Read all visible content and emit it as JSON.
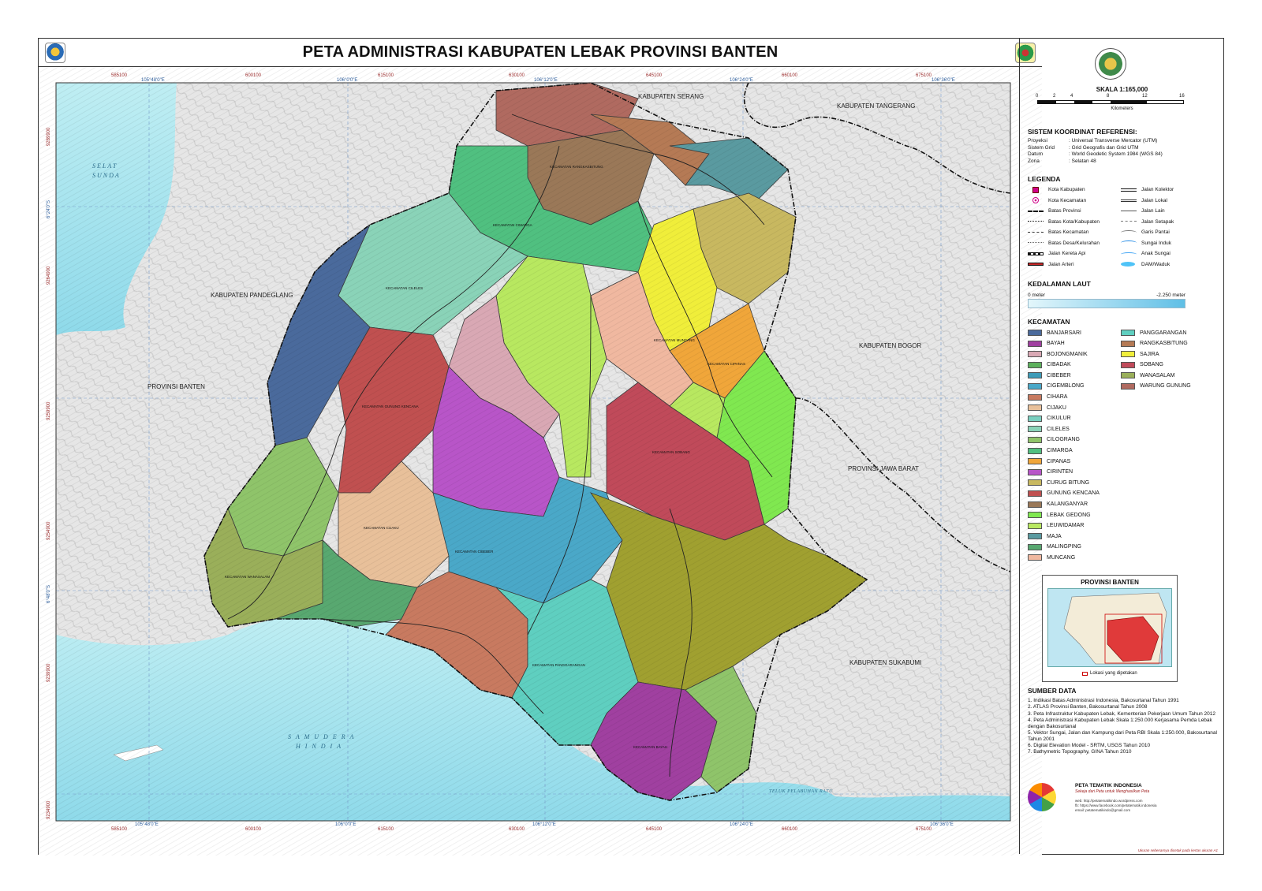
{
  "title": "PETA ADMINISTRASI KABUPATEN LEBAK PROVINSI BANTEN",
  "map": {
    "regions": [
      {
        "label": "KABUPATEN SERANG"
      },
      {
        "label": "KABUPATEN TANGERANG"
      },
      {
        "label": "KABUPATEN PANDEGLANG"
      },
      {
        "label": "PROVINSI BANTEN"
      },
      {
        "label": "KABUPATEN BOGOR"
      },
      {
        "label": "PROVINSI JAWA BARAT"
      },
      {
        "label": "KABUPATEN SUKABUMI"
      }
    ],
    "seas": {
      "selat_line1": "SELAT",
      "selat_line2": "SUNDA",
      "samudera_line1": "S A M U D E R A",
      "samudera_line2": "H I N D I A",
      "teluk": "TELUK PELABUHAN RATU"
    },
    "kecamatan_labels": [
      "KECAMATAN CIMARGA",
      "KECAMATAN CILELES",
      "KECAMATAN MUNCANG",
      "KECAMATAN CIBEBER",
      "KECAMATAN PANGGARANGAN",
      "KECAMATAN WANASALAM",
      "KECAMATAN CIJAKU",
      "KECAMATAN SOBANG",
      "KECAMATAN GUNUNG KENCANA",
      "KECAMATAN BAYAH",
      "KECAMATAN RANGKASBITUNG",
      "KECAMATAN CIPANAS"
    ],
    "grid_top": [
      "585100",
      "105°48'0\"E",
      "600100",
      "106°0'0\"E",
      "615100",
      "630100",
      "106°12'0\"E",
      "645100",
      "106°24'0\"E",
      "660100",
      "675100",
      "106°36'0\"E"
    ],
    "grid_bottom": [
      "585100",
      "105°48'0\"E",
      "600100",
      "106°0'0\"E",
      "615100",
      "630100",
      "106°12'0\"E",
      "645100",
      "106°24'0\"E",
      "660100",
      "675100",
      "106°36'0\"E"
    ],
    "grid_left": [
      "9289900",
      "6°24'0\"S",
      "9264900",
      "9259900",
      "9254900",
      "6°48'0\"S",
      "9239900",
      "9234900"
    ],
    "colors": {
      "sea": "#a9e3ee",
      "land_outside": "#e8e8e8",
      "boundary": "#222222"
    }
  },
  "legend": {
    "scale_title": "SKALA 1:165,000",
    "scale_ticks": [
      "0",
      "2",
      "4",
      "8",
      "12",
      "16"
    ],
    "scale_unit": "Kilometers",
    "crs_title": "SISTEM KOORDINAT REFERENSI:",
    "crs": [
      {
        "k": "Proyeksi",
        "v": ": Universal Transverse Mercator (UTM)"
      },
      {
        "k": "Sistem Grid",
        "v": ": Grid Geografis dan Grid UTM"
      },
      {
        "k": "Datum",
        "v": ": World Geodetic System 1984 (WGS 84)"
      },
      {
        "k": "Zona",
        "v": ": Selatan 48"
      }
    ],
    "legenda_title": "LEGENDA",
    "legenda_items": [
      {
        "label": "Kota Kabupaten",
        "sym": "kabupaten-symbol"
      },
      {
        "label": "Jalan Kolektor",
        "sym": "road-kolektor-symbol"
      },
      {
        "label": "Kota Kecamatan",
        "sym": "kecamatan-symbol"
      },
      {
        "label": "Jalan Lokal",
        "sym": "road-lokal-symbol"
      },
      {
        "label": "Batas Provinsi",
        "sym": "boundary-provinsi-symbol"
      },
      {
        "label": "Jalan Lain",
        "sym": "road-lain-symbol"
      },
      {
        "label": "Batas Kota/Kabupaten",
        "sym": "boundary-kabupaten-symbol"
      },
      {
        "label": "Jalan Setapak",
        "sym": "road-setapak-symbol"
      },
      {
        "label": "Batas Kecamatan",
        "sym": "boundary-kecamatan-symbol"
      },
      {
        "label": "Garis Pantai",
        "sym": "coastline-symbol"
      },
      {
        "label": "Batas Desa/Kelurahan",
        "sym": "boundary-desa-symbol"
      },
      {
        "label": "Sungai Induk",
        "sym": "river-main-symbol"
      },
      {
        "label": "Jalan Kereta Api",
        "sym": "railway-symbol"
      },
      {
        "label": "Anak Sungai",
        "sym": "river-branch-symbol"
      },
      {
        "label": "Jalan Arteri",
        "sym": "road-arteri-symbol"
      },
      {
        "label": "DAM/Waduk",
        "sym": "dam-symbol"
      }
    ],
    "depth_title": "KEDALAMAN LAUT",
    "depth_min": "0 meter",
    "depth_max": "-2.250 meter",
    "kecamatan_title": "KECAMATAN",
    "kecamatan": [
      {
        "name": "BANJARSARI",
        "color": "#4a6a9c"
      },
      {
        "name": "PANGGARANGAN",
        "color": "#5fcfc0"
      },
      {
        "name": "BAYAH",
        "color": "#a040a0"
      },
      {
        "name": "RANGKASBITUNG",
        "color": "#b57a55"
      },
      {
        "name": "BOJONGMANIK",
        "color": "#d9a8b4"
      },
      {
        "name": "SAJIRA",
        "color": "#f0ee3a"
      },
      {
        "name": "CIBADAK",
        "color": "#5cb05c"
      },
      {
        "name": "SOBANG",
        "color": "#c04a5a"
      },
      {
        "name": "CIBEBER",
        "color": "#3f9cb8"
      },
      {
        "name": "WANASALAM",
        "color": "#9aaf5a"
      },
      {
        "name": "CIGEMBLONG",
        "color": "#4aa8c8"
      },
      {
        "name": "WARUNG GUNUNG",
        "color": "#b06a60"
      },
      {
        "name": "CIHARA",
        "color": "#c87a60"
      },
      {
        "name": "",
        "color": ""
      },
      {
        "name": "CIJAKU",
        "color": "#e8c09a"
      },
      {
        "name": "",
        "color": ""
      },
      {
        "name": "CIKULUR",
        "color": "#7ad0c0"
      },
      {
        "name": "",
        "color": ""
      },
      {
        "name": "CILELES",
        "color": "#8ad3b8"
      },
      {
        "name": "",
        "color": ""
      },
      {
        "name": "CILOGRANG",
        "color": "#8fc46a"
      },
      {
        "name": "",
        "color": ""
      },
      {
        "name": "CIMARGA",
        "color": "#50c080"
      },
      {
        "name": "",
        "color": ""
      },
      {
        "name": "CIPANAS",
        "color": "#f0a63a"
      },
      {
        "name": "",
        "color": ""
      },
      {
        "name": "CIRINTEN",
        "color": "#b855c8"
      },
      {
        "name": "",
        "color": ""
      },
      {
        "name": "CURUG BITUNG",
        "color": "#c8b860"
      },
      {
        "name": "",
        "color": ""
      },
      {
        "name": "GUNUNG KENCANA",
        "color": "#c05050"
      },
      {
        "name": "",
        "color": ""
      },
      {
        "name": "KALANGANYAR",
        "color": "#9a7858"
      },
      {
        "name": "",
        "color": ""
      },
      {
        "name": "LEBAK GEDONG",
        "color": "#80e850"
      },
      {
        "name": "",
        "color": ""
      },
      {
        "name": "LEUWIDAMAR",
        "color": "#b8e860"
      },
      {
        "name": "",
        "color": ""
      },
      {
        "name": "MAJA",
        "color": "#5a9aa0"
      },
      {
        "name": "",
        "color": ""
      },
      {
        "name": "MALINGPING",
        "color": "#58a870"
      },
      {
        "name": "",
        "color": ""
      },
      {
        "name": "MUNCANG",
        "color": "#f0b8a0"
      },
      {
        "name": "",
        "color": ""
      }
    ],
    "inset_title": "PROVINSI BANTEN",
    "inset_caption": "Lokasi yang dipetakan",
    "sumber_title": "SUMBER DATA",
    "sumber": [
      "1. Indikasi Batas Administrasi Indonesia, Bakosurtanal Tahun 1991",
      "2. ATLAS Provinsi Banten, Bakosurtanal Tahun 2008",
      "3. Peta Infrastruktur Kabupaten Lebak, Kementerian Pekerjaan Umum Tahun 2012",
      "4. Peta Administrasi Kabupaten Lebak Skala 1:250.000 Kerjasama Pemda Lebak dengan Bakosurtanal",
      "5. Vektor Sungai, Jalan dan Kampung dari Peta RBI Skala 1:250.000, Bakosurtanal Tahun 2001",
      "6. Digital Elevation Model - SRTM, USGS Tahun 2010",
      "7. Bathymetric Topography, GINA Tahun 2010"
    ],
    "publisher_name": "PETA TEMATIK INDONESIA",
    "publisher_tagline": "Sekeja dari Peta untuk Menghasilkan Peta",
    "publisher_contact": [
      "web: http://petatematikindo.wordpress.com",
      "fb: https://www.facebook.com/petatematik.indonesia",
      "email: petatematikindo@gmail.com"
    ],
    "publisher_note": "Ukuran sebenarnya dicetak pada kertas ukuran A1"
  }
}
